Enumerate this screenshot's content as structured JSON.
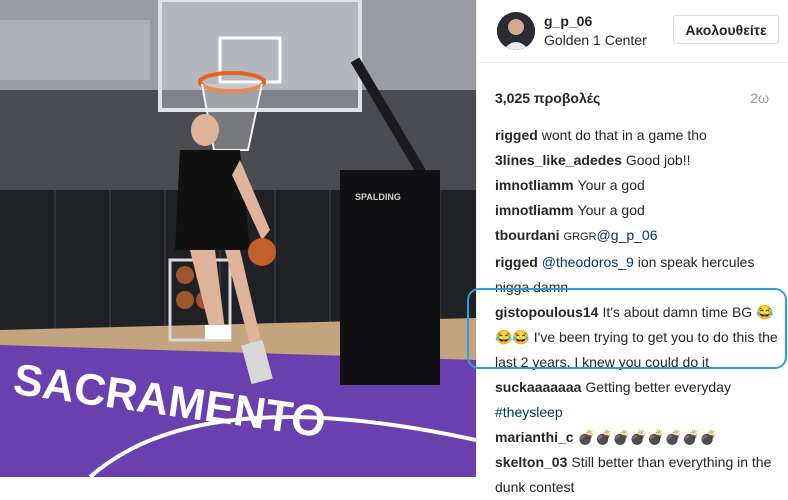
{
  "post": {
    "username": "g_p_06",
    "location": "Golden 1 Center",
    "follow_label": "Ακολουθείτε",
    "views": "3,025 προβολές",
    "time": "2ω"
  },
  "comments": [
    {
      "user": "rigged",
      "text": "wont do that in a game tho"
    },
    {
      "user": "3lines_like_adedes",
      "text": "Good job!!"
    },
    {
      "user": "imnotliamm",
      "text": "Your a god"
    },
    {
      "user": "imnotliamm",
      "text": "Your a god"
    },
    {
      "user": "tbourdani",
      "prefix": "GRGR",
      "mention": "@g_p_06"
    },
    {
      "user": "rigged",
      "mention": "@theodoros_9",
      "text": " ion speak hercules nigga damn"
    },
    {
      "user": "gistopoulous14",
      "text": "It's about damn time BG",
      "emoji": "😂😂😂",
      "text2": " I've been trying to get you to do this the last 2 years. I knew you could do it"
    },
    {
      "user": "suckaaaaaaa",
      "text": "Getting better everyday ",
      "hashtag": "#theysleep"
    },
    {
      "user": "marianthi_c",
      "emoji": "💣💣💣💣💣💣💣💣"
    },
    {
      "user": "skelton_03",
      "text": "Still better than everything in the dunk contest"
    }
  ],
  "video": {
    "court_logo": "SPALDING",
    "court_text": "SACRAMENTO",
    "stanchion_text": "SPALDING"
  },
  "colors": {
    "highlight": "#2aa0d8",
    "link": "#003569",
    "court_purple": "#6a3fae"
  }
}
